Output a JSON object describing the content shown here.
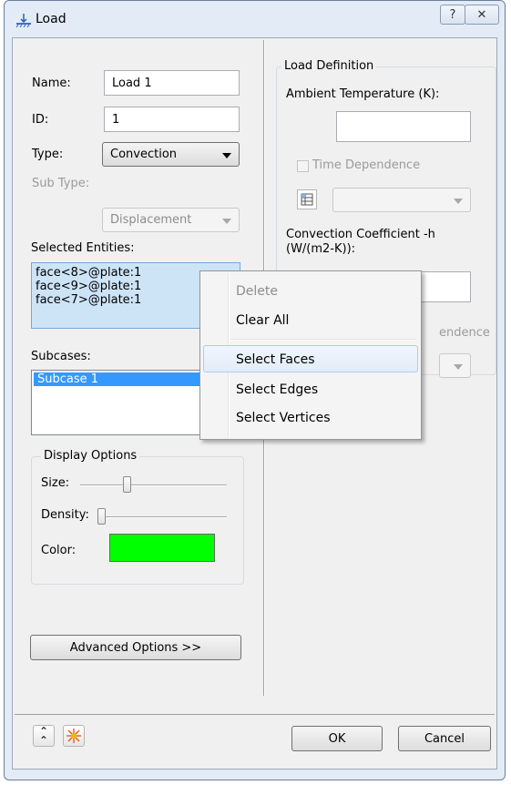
{
  "window": {
    "title": "Load",
    "help_glyph": "?",
    "close_glyph": "✕"
  },
  "form": {
    "name_label": "Name:",
    "name_value": "Load 1",
    "id_label": "ID:",
    "id_value": "1",
    "type_label": "Type:",
    "type_value": "Convection",
    "subtype_label": "Sub Type:",
    "subtype_value": "Displacement",
    "selected_entities_label": "Selected Entities:",
    "selected_entities": [
      "face<8>@plate:1",
      "face<9>@plate:1",
      "face<7>@plate:1"
    ],
    "subcases_label": "Subcases:",
    "subcases": [
      "Subcase 1"
    ]
  },
  "display_options": {
    "title": "Display Options",
    "size_label": "Size:",
    "size_level": 0.3,
    "density_label": "Density:",
    "density_level": 0.0,
    "color_label": "Color:",
    "color_value": "#00ff00"
  },
  "advanced_button": "Advanced Options >>",
  "load_definition": {
    "title": "Load Definition",
    "ambient_label": "Ambient Temperature (K):",
    "ambient_value": "",
    "time_dependence_label": "Time Dependence",
    "convection_label_line1": "Convection Coefficient -h",
    "convection_label_line2": "(W/(m2-K)):",
    "partial_dependence": "endence"
  },
  "context_menu": {
    "items": [
      {
        "label": "Delete",
        "enabled": false
      },
      {
        "label": "Clear All",
        "enabled": true
      },
      {
        "label": "Select Faces",
        "enabled": true,
        "highlighted": true
      },
      {
        "label": "Select Edges",
        "enabled": true
      },
      {
        "label": "Select Vertices",
        "enabled": true
      }
    ]
  },
  "footer": {
    "ok_label": "OK",
    "cancel_label": "Cancel"
  },
  "colors": {
    "selection": "#cde4f7",
    "list_highlight": "#3399ff",
    "accent_green": "#00ff00"
  }
}
